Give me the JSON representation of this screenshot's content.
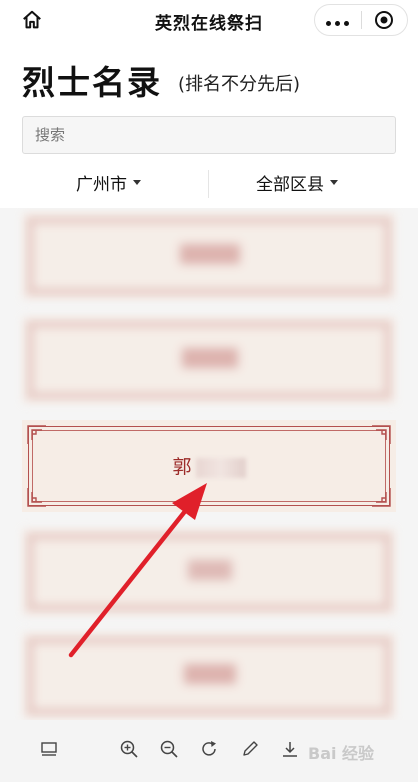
{
  "app": {
    "title": "英烈在线祭扫"
  },
  "header": {
    "title": "烈士名录",
    "subtitle": "(排名不分先后)"
  },
  "search": {
    "placeholder": "搜索"
  },
  "filters": {
    "city": "广州市",
    "district": "全部区县"
  },
  "list": {
    "highlighted_name": "郭"
  },
  "toolbar": {
    "icons": [
      "layout-icon",
      "zoom-in-icon",
      "zoom-out-icon",
      "rotate-icon",
      "pen-icon",
      "download-icon"
    ]
  },
  "watermark": "Bai 经验",
  "colors": {
    "card_background": "#f6ede6",
    "frame_red": "#b3504e",
    "name_red": "#9c2c2a",
    "arrow_red": "#e0202a"
  }
}
